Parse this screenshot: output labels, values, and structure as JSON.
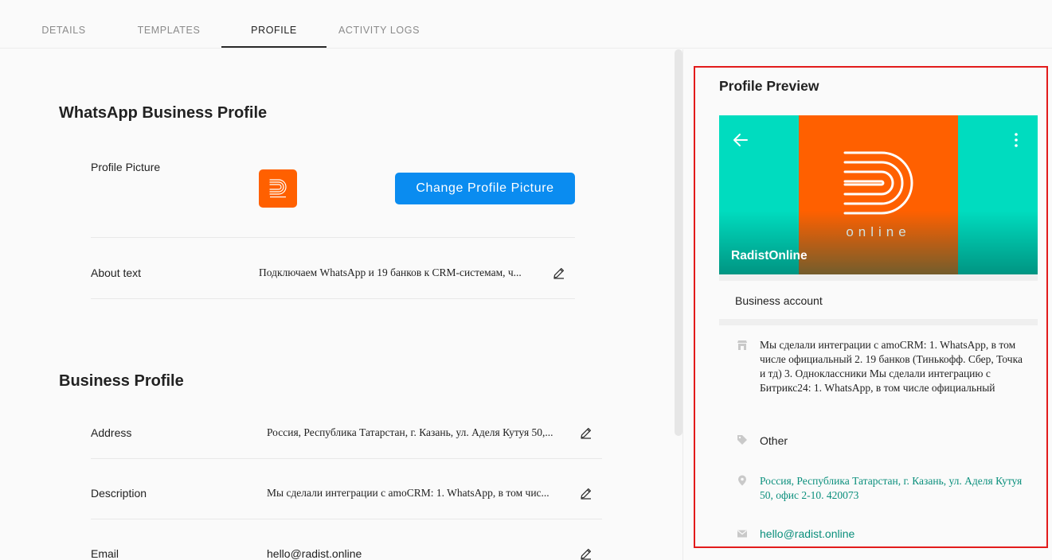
{
  "tabs": [
    {
      "label": "DETAILS",
      "active": false
    },
    {
      "label": "TEMPLATES",
      "active": false
    },
    {
      "label": "PROFILE",
      "active": true
    },
    {
      "label": "ACTIVITY LOGS",
      "active": false
    }
  ],
  "whatsapp_section": {
    "title": "WhatsApp Business Profile",
    "profile_picture_label": "Profile Picture",
    "change_button": "Change Profile Picture",
    "about_label": "About text",
    "about_value": "Подключаем WhatsApp и 19 банков к CRM-системам, ч..."
  },
  "business_section": {
    "title": "Business Profile",
    "address_label": "Address",
    "address_value": "Россия, Республика Татарстан, г. Казань, ул. Аделя Кутуя 50,...",
    "description_label": "Description",
    "description_value": "Мы сделали интеграции с amoCRM: 1. WhatsApp, в том чис...",
    "email_label": "Email",
    "email_value": "hello@radist.online"
  },
  "preview": {
    "title": "Profile Preview",
    "name": "RadistOnline",
    "logo_text": "online",
    "account_type": "Business account",
    "description": "Мы сделали интеграции с amoCRM: 1. WhatsApp, в том числе официальный 2. 19 банков (Тинькофф. Сбер, Точка и тд) 3. Одноклассники Мы сделали интеграцию с Битрикс24: 1. WhatsApp, в том числе официальный",
    "category": "Other",
    "address": "Россия, Республика Татарстан, г. Казань, ул. Аделя Кутуя 50, офис 2-10. 420073",
    "email": "hello@radist.online"
  },
  "colors": {
    "accent_button": "#0a8cf0",
    "brand_orange": "#ff6000",
    "whatsapp_teal": "#00dcbf",
    "link_teal": "#0a8f7c",
    "highlight_border": "#e21b1b"
  }
}
